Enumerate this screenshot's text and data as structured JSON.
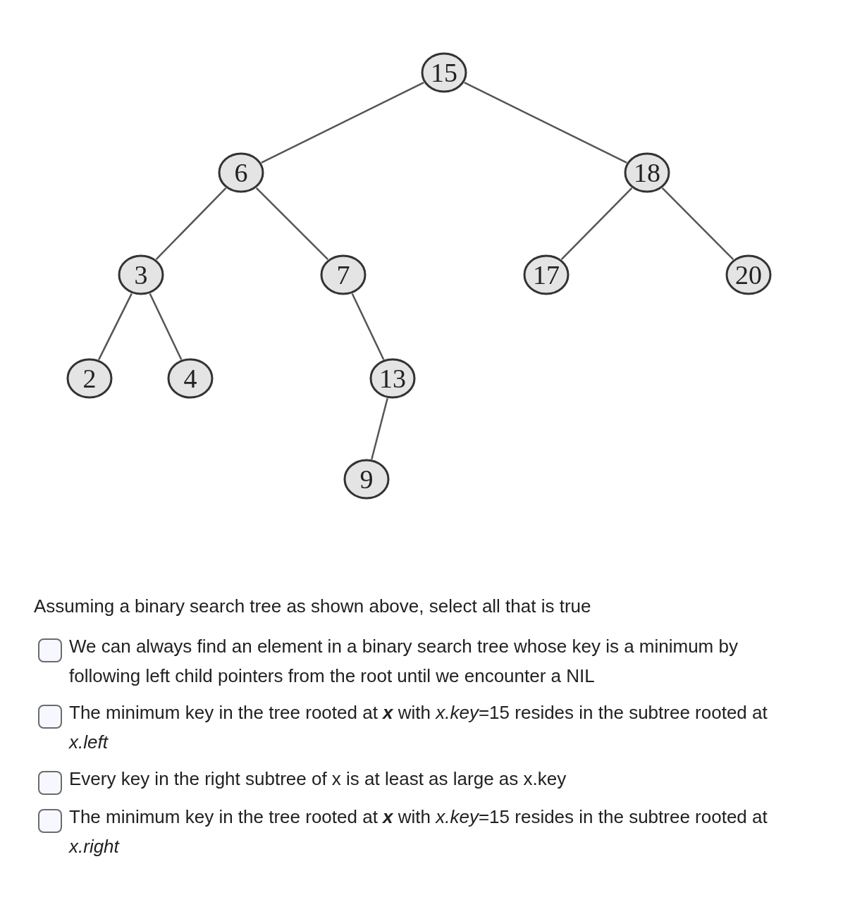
{
  "tree": {
    "key": "15",
    "children": [
      {
        "key": "6",
        "children": [
          {
            "key": "3",
            "children": [
              {
                "key": "2"
              },
              {
                "key": "4"
              }
            ]
          },
          {
            "key": "7",
            "children": [
              {
                "key": "13",
                "children": [
                  {
                    "key": "9"
                  }
                ]
              }
            ]
          }
        ]
      },
      {
        "key": "18",
        "children": [
          {
            "key": "17"
          },
          {
            "key": "20"
          }
        ]
      }
    ]
  },
  "question": "Assuming a binary search tree as shown above, select all that is true",
  "options": [
    {
      "text": "We can always find an element in a binary search tree whose key is a minimum by following left child pointers from the root until we encounter a NIL",
      "checked": false
    },
    {
      "text": "The minimum key in the tree rooted at **x** with *x.key*=15 resides in the subtree rooted at *x.left*",
      "checked": false
    },
    {
      "text": "Every key in the right subtree of x is at least as large as x.key",
      "checked": false
    },
    {
      "text": "The minimum key in the tree rooted at **x** with *x.key*=15 resides in the subtree rooted at *x.right*",
      "checked": false
    }
  ]
}
